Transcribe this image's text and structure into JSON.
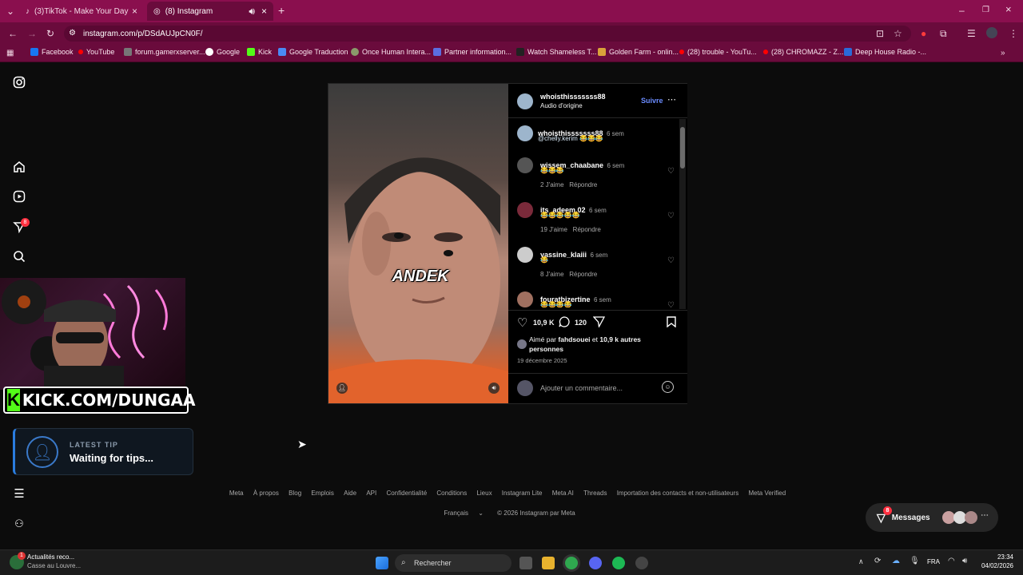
{
  "browser": {
    "tabs": [
      {
        "label": "(3)TikTok - Make Your Day"
      },
      {
        "label": "(8) Instagram"
      }
    ],
    "url": "instagram.com/p/DSdAUJpCN0F/",
    "bookmarks": [
      "Facebook",
      "YouTube",
      "forum.gamerxserver...",
      "Google",
      "Kick",
      "Google Traduction",
      "Once Human Intera...",
      "Partner information...",
      "Watch Shameless T...",
      "Golden Farm - onlin...",
      "(28) trouble - YouTu...",
      "(28) CHROMAZZ - Z...",
      "Deep House Radio -..."
    ]
  },
  "sidebar": {
    "notifications_badge": "8"
  },
  "overlay": {
    "kick_url": "KICK.COM/DUNGAA",
    "tip_title": "LATEST TIP",
    "tip_text": "Waiting for tips..."
  },
  "post": {
    "author": "whoisthisssssss88",
    "audio": "Audio d'origine",
    "follow": "Suivre",
    "video_caption": "ANDEK",
    "caption": {
      "user": "whoisthisssssss88",
      "time": "6 sem",
      "text": "@chelly.kerim 😂😂😂"
    },
    "comments": [
      {
        "user": "wissem_chaabane",
        "time": "6 sem",
        "text": "😂😂😂",
        "likes": "2 J'aime",
        "reply": "Répondre"
      },
      {
        "user": "its_adeem.02",
        "time": "6 sem",
        "text": "😂😂😂😂😂",
        "likes": "19 J'aime",
        "reply": "Répondre"
      },
      {
        "user": "yassine_klaiii",
        "time": "6 sem",
        "text": "😂",
        "likes": "8 J'aime",
        "reply": "Répondre"
      },
      {
        "user": "fouratbizertine",
        "time": "6 sem",
        "text": "😂😂😂😂",
        "likes": "",
        "reply": ""
      }
    ],
    "likes_count": "10,9 K",
    "comments_count": "120",
    "liked_by_prefix": "Aimé par",
    "liked_by_user": "fahdsouei",
    "liked_by_and": "et",
    "liked_by_rest": "10,9 k autres personnes",
    "date": "19 décembre 2025",
    "add_comment_placeholder": "Ajouter un commentaire..."
  },
  "footer": {
    "links": [
      "Meta",
      "À propos",
      "Blog",
      "Emplois",
      "Aide",
      "API",
      "Confidentialité",
      "Conditions",
      "Lieux",
      "Instagram Lite",
      "Meta AI",
      "Threads",
      "Importation des contacts et non-utilisateurs",
      "Meta Verified"
    ],
    "language": "Français",
    "copyright": "© 2026 Instagram par Meta"
  },
  "messages": {
    "label": "Messages",
    "badge": "8"
  },
  "taskbar": {
    "news_title": "Actualités reco...",
    "news_sub": "Casse au Louvre...",
    "news_badge": "1",
    "search": "Rechercher",
    "lang": "FRA",
    "time": "23:34",
    "date": "04/02/2026"
  }
}
